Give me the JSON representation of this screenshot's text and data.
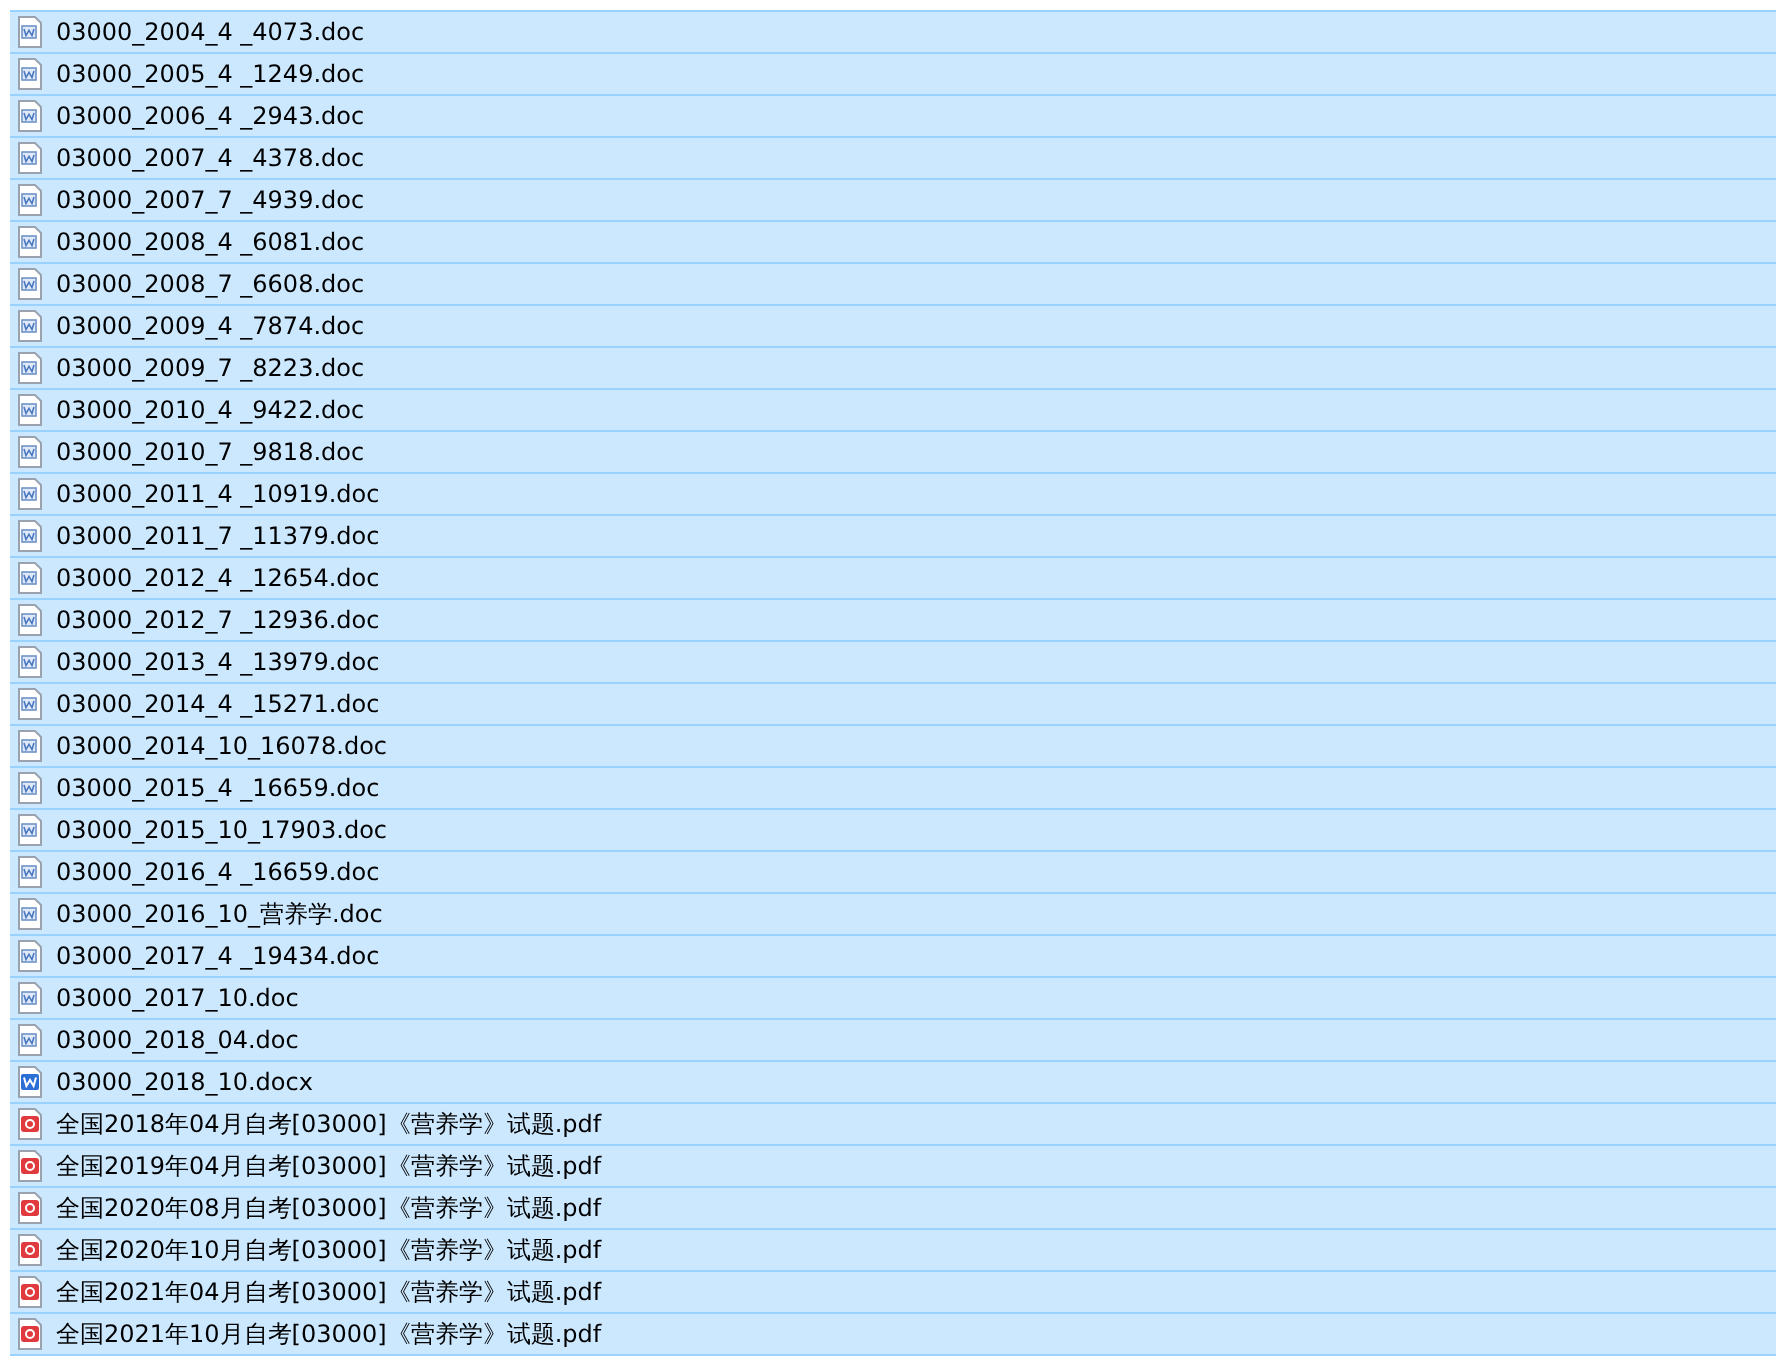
{
  "files": [
    {
      "name": "03000_2004_4 _4073.doc",
      "kind": "doc",
      "selected": true
    },
    {
      "name": "03000_2005_4 _1249.doc",
      "kind": "doc",
      "selected": true
    },
    {
      "name": "03000_2006_4 _2943.doc",
      "kind": "doc",
      "selected": true
    },
    {
      "name": "03000_2007_4 _4378.doc",
      "kind": "doc",
      "selected": true
    },
    {
      "name": "03000_2007_7 _4939.doc",
      "kind": "doc",
      "selected": true
    },
    {
      "name": "03000_2008_4 _6081.doc",
      "kind": "doc",
      "selected": true
    },
    {
      "name": "03000_2008_7 _6608.doc",
      "kind": "doc",
      "selected": true
    },
    {
      "name": "03000_2009_4 _7874.doc",
      "kind": "doc",
      "selected": true
    },
    {
      "name": "03000_2009_7 _8223.doc",
      "kind": "doc",
      "selected": true
    },
    {
      "name": "03000_2010_4 _9422.doc",
      "kind": "doc",
      "selected": true
    },
    {
      "name": "03000_2010_7 _9818.doc",
      "kind": "doc",
      "selected": true
    },
    {
      "name": "03000_2011_4 _10919.doc",
      "kind": "doc",
      "selected": true
    },
    {
      "name": "03000_2011_7 _11379.doc",
      "kind": "doc",
      "selected": true
    },
    {
      "name": "03000_2012_4 _12654.doc",
      "kind": "doc",
      "selected": true
    },
    {
      "name": "03000_2012_7 _12936.doc",
      "kind": "doc",
      "selected": true
    },
    {
      "name": "03000_2013_4 _13979.doc",
      "kind": "doc",
      "selected": true
    },
    {
      "name": "03000_2014_4 _15271.doc",
      "kind": "doc",
      "selected": true
    },
    {
      "name": "03000_2014_10_16078.doc",
      "kind": "doc",
      "selected": true
    },
    {
      "name": "03000_2015_4 _16659.doc",
      "kind": "doc",
      "selected": true
    },
    {
      "name": "03000_2015_10_17903.doc",
      "kind": "doc",
      "selected": true
    },
    {
      "name": "03000_2016_4 _16659.doc",
      "kind": "doc",
      "selected": true
    },
    {
      "name": "03000_2016_10_营养学.doc",
      "kind": "doc",
      "selected": true
    },
    {
      "name": "03000_2017_4 _19434.doc",
      "kind": "doc",
      "selected": true
    },
    {
      "name": "03000_2017_10.doc",
      "kind": "doc",
      "selected": true
    },
    {
      "name": "03000_2018_04.doc",
      "kind": "doc",
      "selected": true
    },
    {
      "name": "03000_2018_10.docx",
      "kind": "docx",
      "selected": true
    },
    {
      "name": "全国2018年04月自考[03000]《营养学》试题.pdf",
      "kind": "pdf",
      "selected": true
    },
    {
      "name": "全国2019年04月自考[03000]《营养学》试题.pdf",
      "kind": "pdf",
      "selected": true
    },
    {
      "name": "全国2020年08月自考[03000]《营养学》试题.pdf",
      "kind": "pdf",
      "selected": true
    },
    {
      "name": "全国2020年10月自考[03000]《营养学》试题.pdf",
      "kind": "pdf",
      "selected": true
    },
    {
      "name": "全国2021年04月自考[03000]《营养学》试题.pdf",
      "kind": "pdf",
      "selected": true
    },
    {
      "name": "全国2021年10月自考[03000]《营养学》试题.pdf",
      "kind": "pdf",
      "selected": true
    }
  ]
}
